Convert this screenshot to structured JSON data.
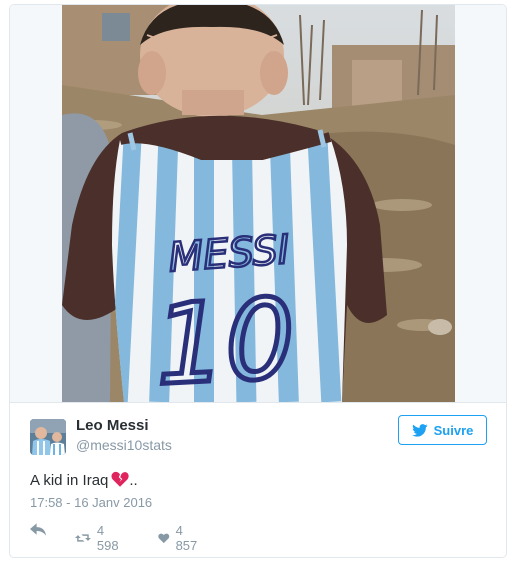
{
  "tweet": {
    "author_name": "Leo Messi",
    "author_handle": "@messi10stats",
    "follow_label": "Suivre",
    "text": "A kid in Iraq",
    "text_suffix": "..",
    "timestamp": "17:58 - 16 Janv 2016",
    "retweets": "4 598",
    "likes": "4 857"
  },
  "photo": {
    "shirt_text_top": "MESSI",
    "shirt_number": "10"
  },
  "colors": {
    "brand_blue": "#1da1f2",
    "muted_text": "#8899a6",
    "broken_heart": "#e0245e"
  },
  "icons": [
    "twitter-bird-icon",
    "broken-heart-icon",
    "reply-icon",
    "retweet-icon",
    "like-heart-icon"
  ]
}
